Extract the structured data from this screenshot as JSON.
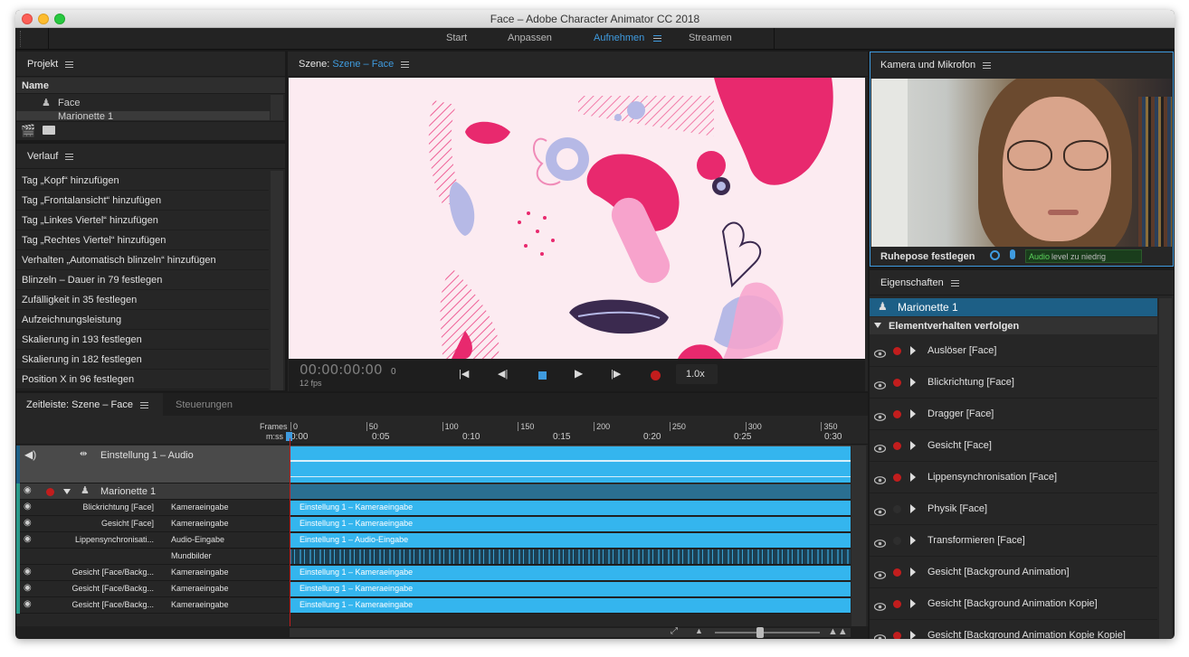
{
  "window": {
    "title": "Face – Adobe Character Animator CC 2018"
  },
  "workspace": {
    "tabs": [
      {
        "label": "Start",
        "active": false
      },
      {
        "label": "Anpassen",
        "active": false
      },
      {
        "label": "Aufnehmen",
        "active": true
      },
      {
        "label": "Streamen",
        "active": false
      }
    ]
  },
  "project": {
    "title": "Projekt",
    "column_name": "Name",
    "items": [
      "Face",
      "Marionette 1"
    ]
  },
  "history": {
    "title": "Verlauf",
    "items": [
      "Tag „Kopf“ hinzufügen",
      "Tag „Frontalansicht“ hinzufügen",
      "Tag „Linkes Viertel“ hinzufügen",
      "Tag „Rechtes Viertel“ hinzufügen",
      "Verhalten „Automatisch blinzeln“ hinzufügen",
      "Blinzeln – Dauer in 79 festlegen",
      "Zufälligkeit in 35 festlegen",
      "Aufzeichnungsleistung",
      "Skalierung in 193 festlegen",
      "Skalierung in 182 festlegen",
      "Position X in 96 festlegen"
    ]
  },
  "scene": {
    "label": "Szene:",
    "name": "Szene – Face",
    "timecode": "00:00:00:00",
    "frame": "0",
    "fps": "12 fps",
    "speed": "1.0x"
  },
  "camera": {
    "title": "Kamera und Mikrofon",
    "rest_pose": "Ruhepose festlegen",
    "audio_a": "Audio",
    "audio_b": "level zu niedrig"
  },
  "properties": {
    "title": "Eigenschaften",
    "puppet": "Marionette 1",
    "section": "Elementverhalten verfolgen",
    "behaviors": [
      {
        "label": "Auslöser [Face]",
        "armed": true
      },
      {
        "label": "Blickrichtung [Face]",
        "armed": true
      },
      {
        "label": "Dragger [Face]",
        "armed": true
      },
      {
        "label": "Gesicht [Face]",
        "armed": true
      },
      {
        "label": "Lippensynchronisation [Face]",
        "armed": true
      },
      {
        "label": "Physik [Face]",
        "armed": false
      },
      {
        "label": "Transformieren [Face]",
        "armed": false
      },
      {
        "label": "Gesicht [Background Animation]",
        "armed": true
      },
      {
        "label": "Gesicht [Background Animation Kopie]",
        "armed": true
      },
      {
        "label": "Gesicht [Background Animation Kopie Kopie]",
        "armed": true
      }
    ]
  },
  "timeline": {
    "title": "Zeitleiste: Szene – Face",
    "tab2": "Steuerungen",
    "frames_label": "Frames",
    "time_label": "m:ss",
    "frame_ticks": [
      "0",
      "50",
      "100",
      "150",
      "200",
      "250",
      "300",
      "350"
    ],
    "time_ticks": [
      "0:00",
      "0:05",
      "0:10",
      "0:15",
      "0:20",
      "0:25",
      "0:30"
    ],
    "audio_track": "Einstellung 1 – Audio",
    "puppet_track": "Marionette 1",
    "rows": [
      {
        "name": "Blickrichtung [Face]",
        "source": "Kameraeingabe",
        "clip": "Einstellung 1 – Kameraeingabe"
      },
      {
        "name": "Gesicht [Face]",
        "source": "Kameraeingabe",
        "clip": "Einstellung 1 – Kameraeingabe"
      },
      {
        "name": "Lippensynchronisati...",
        "source": "Audio-Eingabe",
        "clip": "Einstellung 1 – Audio-Eingabe"
      },
      {
        "name": "",
        "source": "Mundbilder",
        "clip": ""
      },
      {
        "name": "Gesicht [Face/Backg...",
        "source": "Kameraeingabe",
        "clip": "Einstellung 1 – Kameraeingabe"
      },
      {
        "name": "Gesicht [Face/Backg...",
        "source": "Kameraeingabe",
        "clip": "Einstellung 1 – Kameraeingabe"
      },
      {
        "name": "Gesicht [Face/Backg...",
        "source": "Kameraeingabe",
        "clip": "Einstellung 1 – Kameraeingabe"
      }
    ]
  },
  "colors": {
    "accent": "#3f9bdf",
    "clip": "#34b5ee",
    "record": "#c21d1d",
    "panel": "#262626"
  }
}
